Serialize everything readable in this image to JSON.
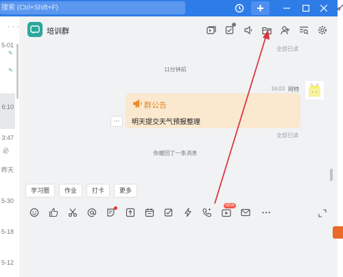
{
  "titlebar": {
    "search_placeholder": "搜索 (Ctrl+Shift+F)",
    "plus_label": "+"
  },
  "conversation_list": {
    "menu_label": "· · ·",
    "times": [
      "5-01",
      "6:10",
      "3:47",
      "昨天",
      "5-30",
      "5-18",
      "5-12"
    ],
    "glyph": "必"
  },
  "chat": {
    "group_name": "培训群",
    "header_icons": [
      "screen-share-icon",
      "task-icon",
      "announcement-icon",
      "folder-icon",
      "add-member-icon",
      "search-history-icon",
      "settings-icon"
    ],
    "messages": {
      "read_top": "全部已读",
      "time_separator": "11分钟前",
      "message_time": "16:03",
      "message_sender": "阿特",
      "notice_title": "群公告",
      "notice_body": "明天提交天气预报整理",
      "more_label": "···",
      "read_bottom": "全部已读",
      "recall_note": "你撤回了一条消息"
    },
    "quick_actions": [
      "学习圈",
      "作业",
      "打卡",
      "更多"
    ],
    "input_toolbar": {
      "new_badge": "NEW",
      "icons": [
        "emoji-icon",
        "like-icon",
        "scissors-icon",
        "mention-icon",
        "sticky-note-icon",
        "upload-file-icon",
        "calendar-icon",
        "checkbox-icon",
        "lightning-icon",
        "voice-call-icon",
        "video-icon",
        "mail-icon",
        "more-icon"
      ]
    }
  },
  "colors": {
    "titlebar": "#2e7ce8",
    "chat_bg": "#f1f2f4",
    "group_avatar": "#2aa79a",
    "notice_bg": "#fae8cf",
    "notice_title": "#e0892a",
    "annotation_arrow": "#d9363e"
  }
}
